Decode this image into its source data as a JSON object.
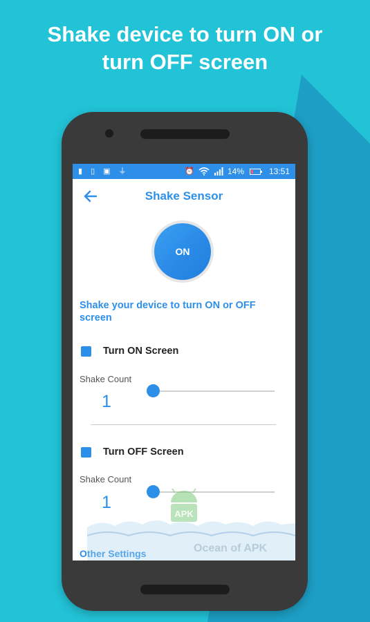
{
  "headline": {
    "line1": "Shake device to turn ON or",
    "line2": "turn OFF  screen"
  },
  "statusbar": {
    "battery_percent": "14%",
    "time": "13:51",
    "icons_left": [
      "battery-saver-icon",
      "phone-icon",
      "image-icon",
      "usb-icon"
    ],
    "icons_right": [
      "alarm-icon",
      "wifi-icon",
      "signal-icon"
    ]
  },
  "appbar": {
    "title": "Shake Sensor",
    "back_icon": "arrow-left-icon"
  },
  "toggle": {
    "label": "ON",
    "state": "on"
  },
  "description": "Shake your device to turn ON or OFF screen",
  "turn_on": {
    "label": "Turn ON Screen",
    "checked": true,
    "shake_count_label": "Shake Count",
    "count": "1",
    "slider_fraction": 0.0
  },
  "turn_off": {
    "label": "Turn OFF Screen",
    "checked": true,
    "shake_count_label": "Shake Count",
    "count": "1",
    "slider_fraction": 0.0
  },
  "other_settings": "Other Settings",
  "watermark": {
    "badge": "APK",
    "text": "Ocean of APK"
  },
  "colors": {
    "background": "#22c3d7",
    "background_shadow": "#1a9ec2",
    "accent": "#2d8fe8",
    "phone_body": "#3a3a3a"
  }
}
